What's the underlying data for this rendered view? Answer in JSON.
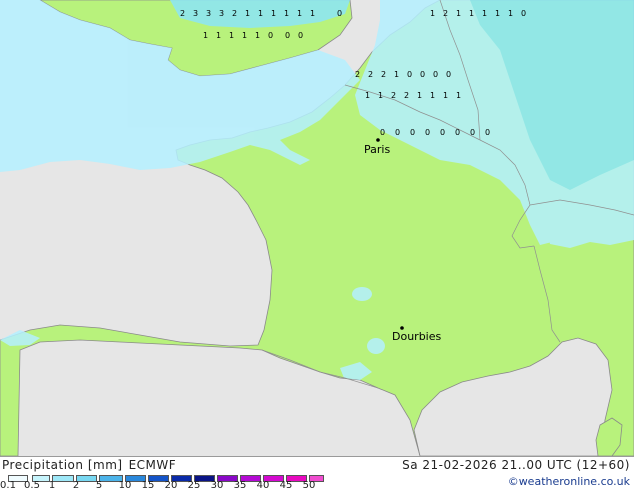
{
  "map": {
    "cities": [
      {
        "name": "Paris"
      },
      {
        "name": "Dourbies"
      }
    ],
    "colors": {
      "sea": "#e6e6e6",
      "land": "#b8f27c",
      "precip_light": "#b4f0ff",
      "precip_medium": "#8ce6f8",
      "border": "#a0a0a0",
      "coast": "#8a8a8a"
    },
    "grid_values": [
      "2",
      "3",
      "3",
      "3",
      "2",
      "1",
      "1",
      "1",
      "1",
      "1",
      "1",
      "0",
      "1",
      "2",
      "1",
      "1",
      "1",
      "1",
      "1",
      "0",
      "1",
      "1",
      "1",
      "1",
      "1",
      "0",
      "0",
      "0",
      "2",
      "2",
      "2",
      "1",
      "0",
      "0",
      "0",
      "0",
      "1",
      "1",
      "2",
      "2",
      "1",
      "1",
      "1",
      "1",
      "0",
      "0",
      "0",
      "0",
      "0",
      "0",
      "0",
      "0"
    ]
  },
  "legend": {
    "title": "Precipitation [mm]",
    "model": "ECMWF",
    "scale_labels": [
      "0.1",
      "0.5",
      "1",
      "2",
      "5",
      "10",
      "15",
      "20",
      "25",
      "30",
      "35",
      "40",
      "45",
      "50"
    ],
    "scale_colors": [
      "#f0fcff",
      "#c6f4fc",
      "#9ee8f8",
      "#78d8f2",
      "#4cb4ea",
      "#2a88dc",
      "#1454c8",
      "#0a2aa8",
      "#0a1486",
      "#8a08c8",
      "#b40ad4",
      "#d40ad0",
      "#e80ac0",
      "#f04cd0"
    ]
  },
  "valid_time": "Sa 21-02-2026 21..00 UTC (12+60)",
  "credit": "©weatheronline.co.uk"
}
